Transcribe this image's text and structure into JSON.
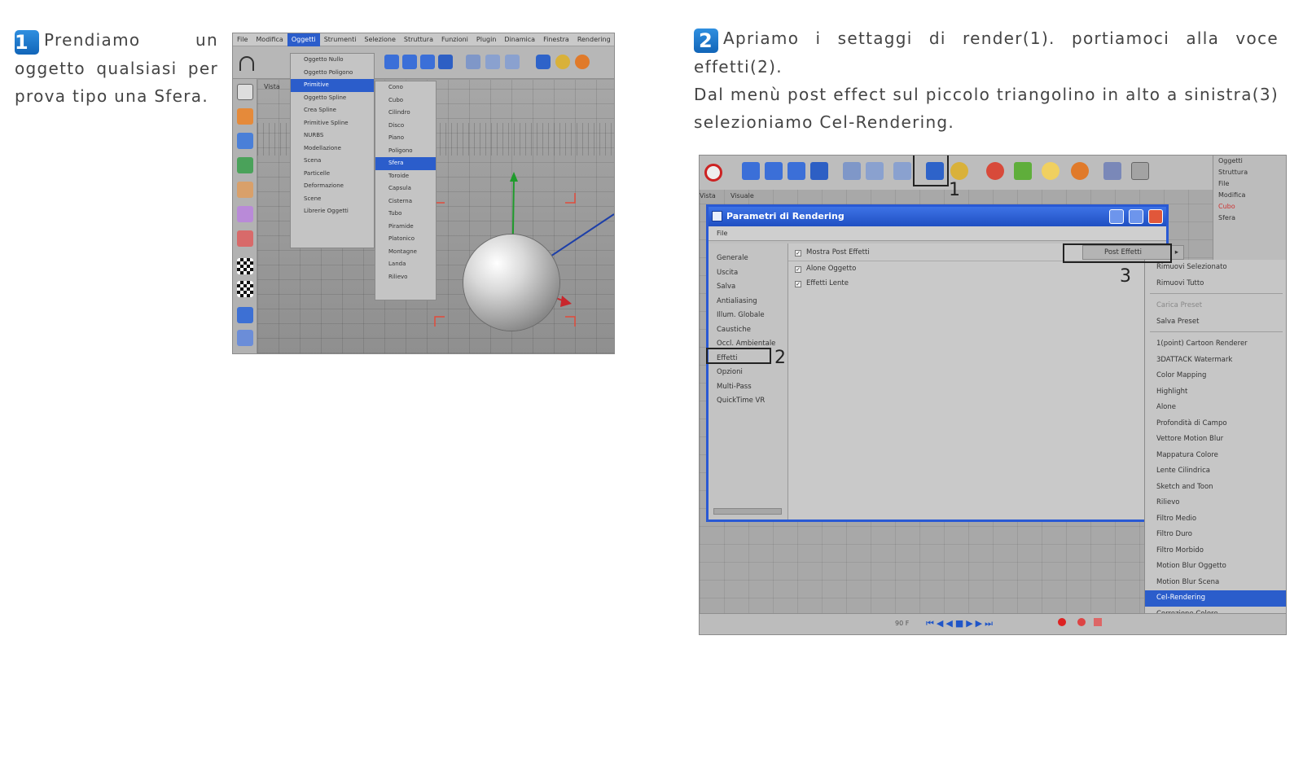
{
  "step1": {
    "number": "1",
    "text": "Prendiamo un oggetto qualsiasi per prova tipo una Sfera."
  },
  "step2": {
    "number": "2",
    "line1": "Apriamo i settaggi di render(1). portiamoci alla voce effetti(2).",
    "line2": "Dal menù post effect sul piccolo triangolino in alto a sinistra(3) selezioniamo Cel-Rendering."
  },
  "screenshot1": {
    "menubar": [
      "File",
      "Modifica",
      "Oggetti",
      "Strumenti",
      "Selezione",
      "Struttura",
      "Funzioni",
      "Plugin",
      "Dinamica",
      "Finestra",
      "Rendering"
    ],
    "menu_oggetti": [
      "Oggetto Nullo",
      "Oggetto Poligono",
      "Primitive",
      "Oggetto Spline",
      "Crea Spline",
      "Primitive Spline",
      "NURBS",
      "Modellazione",
      "Scena",
      "Particelle",
      "Deformazione",
      "Scene",
      "Librerie Oggetti"
    ],
    "menu_primitive": [
      "Cono",
      "Cubo",
      "Cilindro",
      "Disco",
      "Piano",
      "Poligono",
      "Sfera",
      "Toroide",
      "Capsula",
      "Cisterna",
      "Tubo",
      "Piramide",
      "Platonico",
      "Montagne",
      "Landa",
      "Rilievo"
    ],
    "highlighted_oggetti": "Primitive",
    "highlighted_primitive": "Sfera",
    "side_tab": "Vista"
  },
  "screenshot2": {
    "toolbar_tabs": [
      "Vista",
      "Visuale"
    ],
    "right_panel": [
      "Oggetti",
      "Struttura",
      "File",
      "Modifica",
      "Cubo",
      "Sfera"
    ],
    "dialog": {
      "title": "Parametri di Rendering",
      "menu": "File",
      "sections": [
        "Generale",
        "Uscita",
        "Salva",
        "Antialiasing",
        "Illum. Globale",
        "Caustiche",
        "Occl. Ambientale",
        "Effetti",
        "Opzioni",
        "Multi-Pass",
        "QuickTime VR"
      ],
      "header_check": "Mostra Post Effetti",
      "effects": [
        "Alone Oggetto",
        "Effetti Lente"
      ],
      "post_effect_button": "Post Effetti"
    },
    "post_effect_menu": {
      "group1": [
        "Rimuovi Selezionato",
        "Rimuovi Tutto"
      ],
      "group2": [
        "Carica Preset",
        "Salva Preset"
      ],
      "group3": [
        "Cel-Rendering",
        "Color Mapping",
        "Highlight",
        "Alone",
        "Profondità di Campo",
        "Vettore Motion Blur",
        "Mappatura Colore",
        "Lente Cilindrica",
        "Sketch and Toon",
        "Rilievo",
        "Filtro Medio",
        "Filtro Duro",
        "Filtro Morbido",
        "Motion Blur Oggetto",
        "Motion Blur Scena",
        "Cel-Rendering",
        "Correzione Colore"
      ],
      "first_items": [
        "1(point) Cartoon Renderer",
        "3DATTACK Watermark"
      ],
      "selected": "Cel-Rendering"
    },
    "timeline_frame": "90 F",
    "callouts": [
      "1",
      "2",
      "3"
    ]
  }
}
